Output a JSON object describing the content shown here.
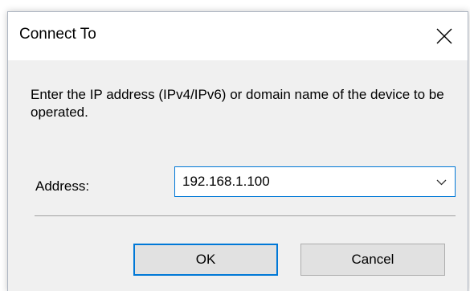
{
  "dialog": {
    "title": "Connect To",
    "prompt": "Enter the IP address (IPv4/IPv6) or domain name of the device to be operated.",
    "address_label": "Address:",
    "address_value": "192.168.1.100",
    "ok_label": "OK",
    "cancel_label": "Cancel"
  },
  "icons": {
    "close": "close-icon",
    "dropdown": "chevron-down-icon"
  },
  "colors": {
    "focus_accent": "#0078d7",
    "dialog_background": "#f0f0f0",
    "titlebar_background": "#ffffff"
  }
}
